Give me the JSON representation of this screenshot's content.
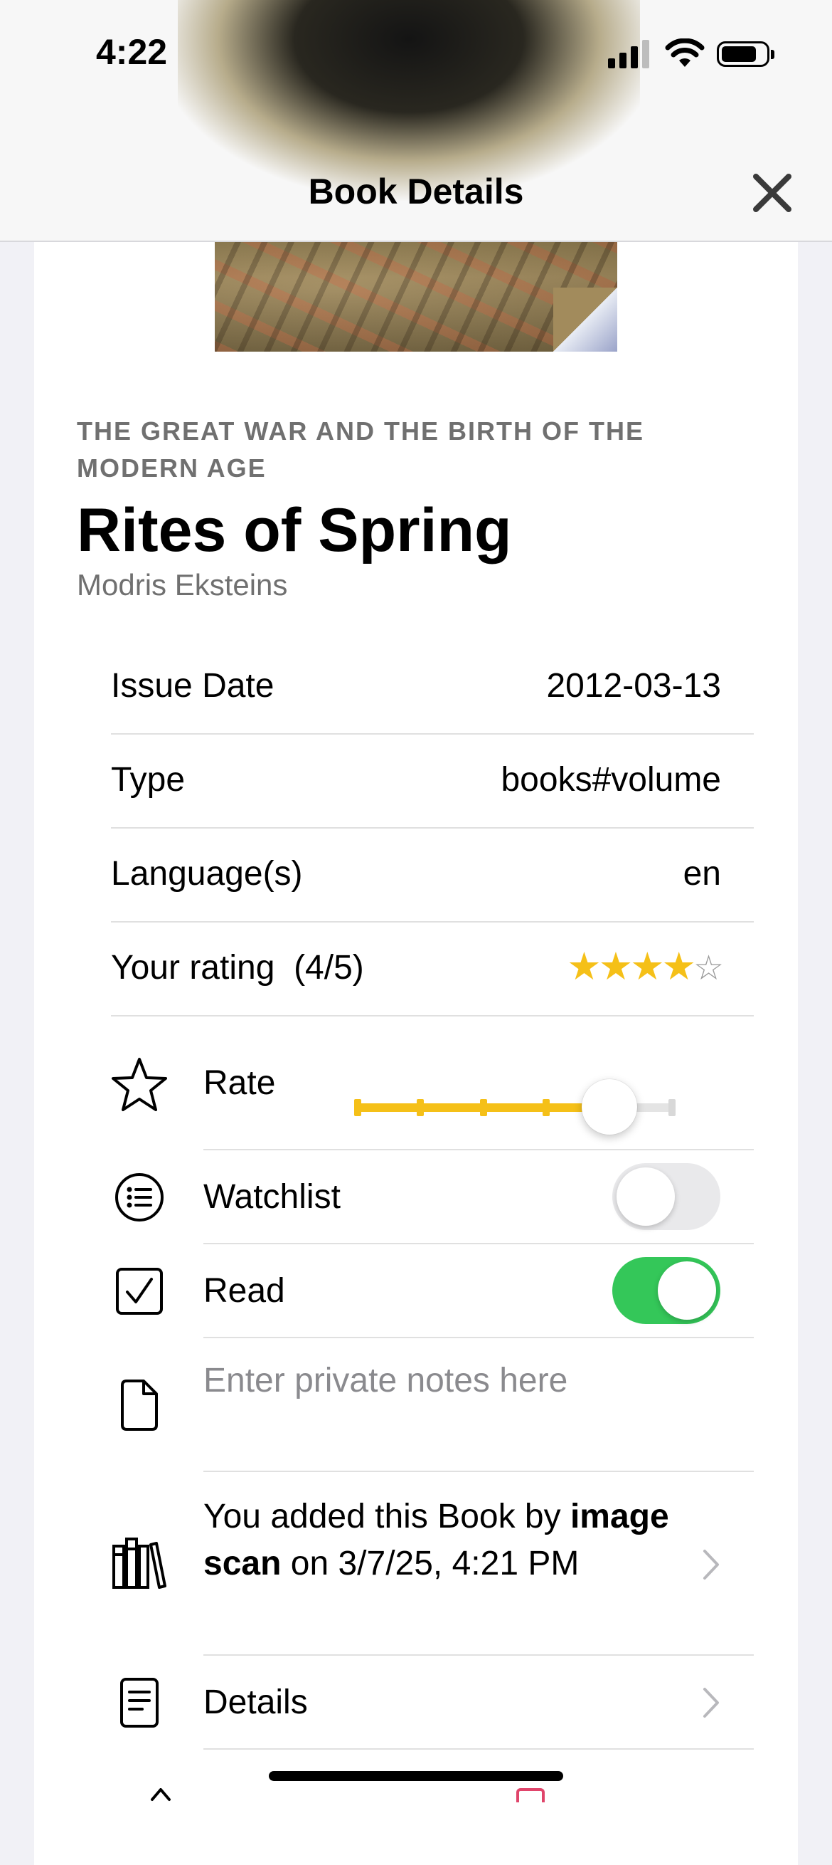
{
  "status_bar": {
    "time": "4:22"
  },
  "nav": {
    "title": "Book Details",
    "close_icon": "close-icon"
  },
  "book": {
    "series": "THE GREAT WAR AND THE BIRTH OF THE MODERN AGE",
    "title": "Rites of Spring",
    "author": "Modris Eksteins"
  },
  "info": [
    {
      "label": "Issue Date",
      "value": "2012-03-13"
    },
    {
      "label": "Type",
      "value": "books#volume"
    },
    {
      "label": "Language(s)",
      "value": "en"
    }
  ],
  "rating": {
    "label": "Your rating  (4/5)",
    "value": 4,
    "max": 5
  },
  "actions": {
    "rate": {
      "label": "Rate",
      "icon": "star-outline-icon",
      "slider_value": 4,
      "slider_max": 5
    },
    "watchlist": {
      "label": "Watchlist",
      "icon": "list-circle-icon",
      "on": false
    },
    "read": {
      "label": "Read",
      "icon": "checkbox-icon",
      "on": true
    },
    "notes": {
      "placeholder": "Enter private notes here",
      "icon": "document-icon"
    },
    "added": {
      "prefix": "You added this Book by",
      "method": "image scan",
      "suffix": "on 3/7/25, 4:21 PM",
      "icon": "books-library-icon"
    },
    "details": {
      "label": "Details",
      "icon": "doc-text-icon"
    }
  },
  "colors": {
    "accent": "#f5c018",
    "toggle_on": "#34c759",
    "toggle_off": "#e9e9eb",
    "secondary_text": "#707070"
  }
}
